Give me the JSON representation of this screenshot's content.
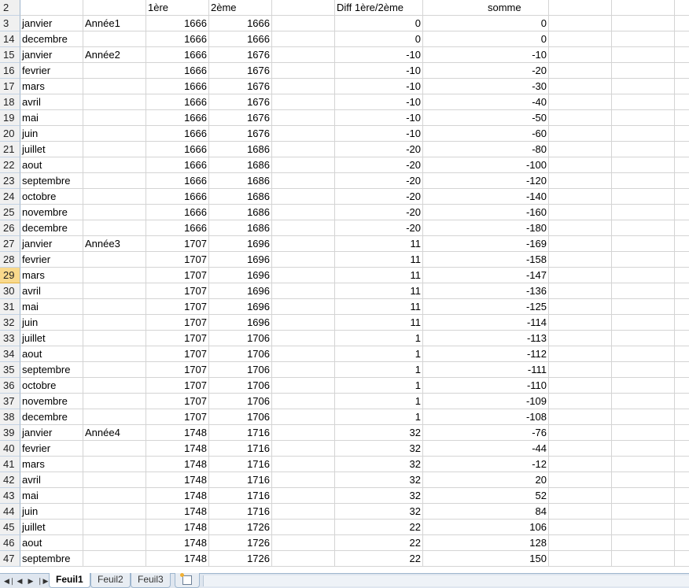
{
  "header_row": {
    "row_number": "2",
    "col_c": "1ère",
    "col_d": "2ème",
    "col_f": "Diff 1ère/2ème",
    "col_g": "somme"
  },
  "rows": [
    {
      "n": "3",
      "month": "janvier",
      "year": "Année1",
      "first": "1666",
      "second": "1666",
      "diff": "0",
      "sum": "0"
    },
    {
      "n": "14",
      "month": "decembre",
      "year": "",
      "first": "1666",
      "second": "1666",
      "diff": "0",
      "sum": "0"
    },
    {
      "n": "15",
      "month": "janvier",
      "year": "Année2",
      "first": "1666",
      "second": "1676",
      "diff": "-10",
      "sum": "-10"
    },
    {
      "n": "16",
      "month": "fevrier",
      "year": "",
      "first": "1666",
      "second": "1676",
      "diff": "-10",
      "sum": "-20"
    },
    {
      "n": "17",
      "month": "mars",
      "year": "",
      "first": "1666",
      "second": "1676",
      "diff": "-10",
      "sum": "-30"
    },
    {
      "n": "18",
      "month": "avril",
      "year": "",
      "first": "1666",
      "second": "1676",
      "diff": "-10",
      "sum": "-40"
    },
    {
      "n": "19",
      "month": "mai",
      "year": "",
      "first": "1666",
      "second": "1676",
      "diff": "-10",
      "sum": "-50"
    },
    {
      "n": "20",
      "month": "juin",
      "year": "",
      "first": "1666",
      "second": "1676",
      "diff": "-10",
      "sum": "-60"
    },
    {
      "n": "21",
      "month": "juillet",
      "year": "",
      "first": "1666",
      "second": "1686",
      "diff": "-20",
      "sum": "-80"
    },
    {
      "n": "22",
      "month": "aout",
      "year": "",
      "first": "1666",
      "second": "1686",
      "diff": "-20",
      "sum": "-100"
    },
    {
      "n": "23",
      "month": "septembre",
      "year": "",
      "first": "1666",
      "second": "1686",
      "diff": "-20",
      "sum": "-120"
    },
    {
      "n": "24",
      "month": "octobre",
      "year": "",
      "first": "1666",
      "second": "1686",
      "diff": "-20",
      "sum": "-140"
    },
    {
      "n": "25",
      "month": "novembre",
      "year": "",
      "first": "1666",
      "second": "1686",
      "diff": "-20",
      "sum": "-160"
    },
    {
      "n": "26",
      "month": "decembre",
      "year": "",
      "first": "1666",
      "second": "1686",
      "diff": "-20",
      "sum": "-180"
    },
    {
      "n": "27",
      "month": "janvier",
      "year": "Année3",
      "first": "1707",
      "second": "1696",
      "diff": "11",
      "sum": "-169"
    },
    {
      "n": "28",
      "month": "fevrier",
      "year": "",
      "first": "1707",
      "second": "1696",
      "diff": "11",
      "sum": "-158"
    },
    {
      "n": "29",
      "month": "mars",
      "year": "",
      "first": "1707",
      "second": "1696",
      "diff": "11",
      "sum": "-147"
    },
    {
      "n": "30",
      "month": "avril",
      "year": "",
      "first": "1707",
      "second": "1696",
      "diff": "11",
      "sum": "-136"
    },
    {
      "n": "31",
      "month": "mai",
      "year": "",
      "first": "1707",
      "second": "1696",
      "diff": "11",
      "sum": "-125"
    },
    {
      "n": "32",
      "month": "juin",
      "year": "",
      "first": "1707",
      "second": "1696",
      "diff": "11",
      "sum": "-114"
    },
    {
      "n": "33",
      "month": "juillet",
      "year": "",
      "first": "1707",
      "second": "1706",
      "diff": "1",
      "sum": "-113"
    },
    {
      "n": "34",
      "month": "aout",
      "year": "",
      "first": "1707",
      "second": "1706",
      "diff": "1",
      "sum": "-112"
    },
    {
      "n": "35",
      "month": "septembre",
      "year": "",
      "first": "1707",
      "second": "1706",
      "diff": "1",
      "sum": "-111"
    },
    {
      "n": "36",
      "month": "octobre",
      "year": "",
      "first": "1707",
      "second": "1706",
      "diff": "1",
      "sum": "-110"
    },
    {
      "n": "37",
      "month": "novembre",
      "year": "",
      "first": "1707",
      "second": "1706",
      "diff": "1",
      "sum": "-109"
    },
    {
      "n": "38",
      "month": "decembre",
      "year": "",
      "first": "1707",
      "second": "1706",
      "diff": "1",
      "sum": "-108"
    },
    {
      "n": "39",
      "month": "janvier",
      "year": "Année4",
      "first": "1748",
      "second": "1716",
      "diff": "32",
      "sum": "-76"
    },
    {
      "n": "40",
      "month": "fevrier",
      "year": "",
      "first": "1748",
      "second": "1716",
      "diff": "32",
      "sum": "-44"
    },
    {
      "n": "41",
      "month": "mars",
      "year": "",
      "first": "1748",
      "second": "1716",
      "diff": "32",
      "sum": "-12"
    },
    {
      "n": "42",
      "month": "avril",
      "year": "",
      "first": "1748",
      "second": "1716",
      "diff": "32",
      "sum": "20"
    },
    {
      "n": "43",
      "month": "mai",
      "year": "",
      "first": "1748",
      "second": "1716",
      "diff": "32",
      "sum": "52"
    },
    {
      "n": "44",
      "month": "juin",
      "year": "",
      "first": "1748",
      "second": "1716",
      "diff": "32",
      "sum": "84"
    },
    {
      "n": "45",
      "month": "juillet",
      "year": "",
      "first": "1748",
      "second": "1726",
      "diff": "22",
      "sum": "106"
    },
    {
      "n": "46",
      "month": "aout",
      "year": "",
      "first": "1748",
      "second": "1726",
      "diff": "22",
      "sum": "128"
    },
    {
      "n": "47",
      "month": "septembre",
      "year": "",
      "first": "1748",
      "second": "1726",
      "diff": "22",
      "sum": "150"
    }
  ],
  "selected_row": "29",
  "sheet_tabs": [
    "Feuil1",
    "Feuil2",
    "Feuil3"
  ],
  "active_tab": "Feuil1",
  "nav_icons": [
    "first-sheet-icon",
    "prev-sheet-icon",
    "next-sheet-icon",
    "last-sheet-icon"
  ],
  "new_sheet_icon": "insert-sheet-icon",
  "colors": {
    "row_header_bg": "#f0f0f0",
    "selected_row_header_bg": "#f9d98c",
    "gridline": "#d4d4d4",
    "tabbar_bg": "#dfe6ef"
  }
}
